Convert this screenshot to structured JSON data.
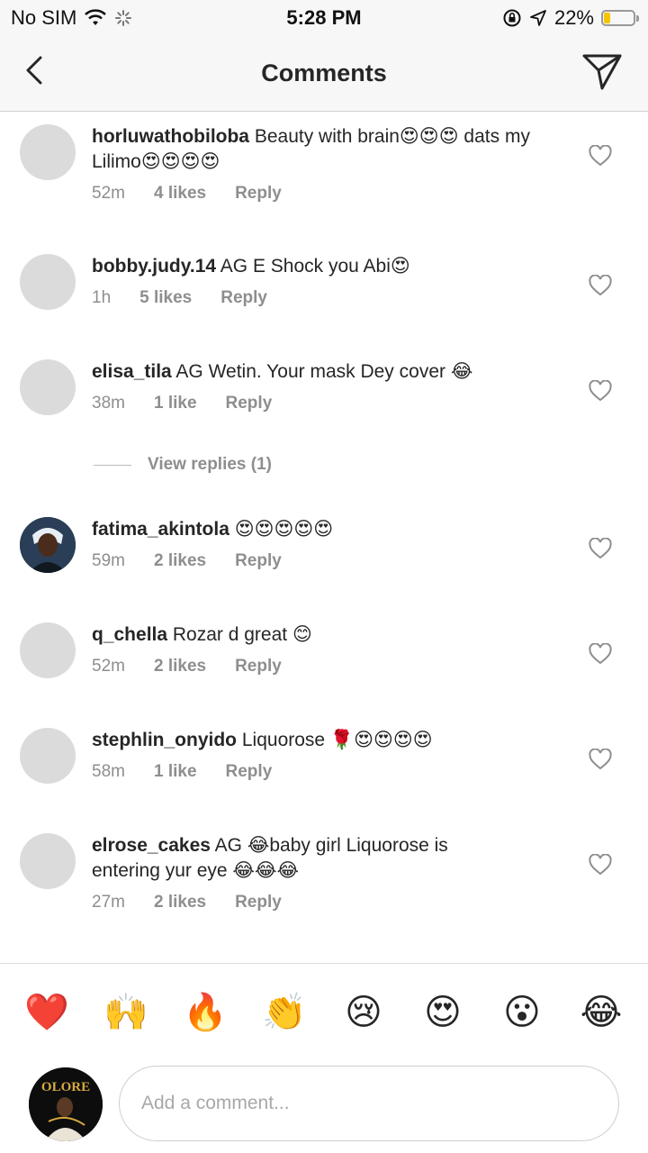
{
  "status": {
    "carrier": "No SIM",
    "time": "5:28 PM",
    "battery_text": "22%",
    "battery_level": 0.22
  },
  "header": {
    "title": "Comments"
  },
  "comments": [
    {
      "username": "horluwathobiloba",
      "text": "Beauty with brain😍😍😍 dats my Lilimo😍😍😍😍",
      "time": "52m",
      "likes": "4 likes",
      "reply": "Reply",
      "avatar": "placeholder"
    },
    {
      "username": "bobby.judy.14",
      "text": "AG E Shock you Abi😍",
      "time": "1h",
      "likes": "5 likes",
      "reply": "Reply",
      "avatar": "placeholder"
    },
    {
      "username": "elisa_tila",
      "text": "AG Wetin. Your mask Dey cover 😂",
      "time": "38m",
      "likes": "1 like",
      "reply": "Reply",
      "avatar": "placeholder"
    },
    {
      "username": "fatima_akintola",
      "text": "😍😍😍😍😍",
      "time": "59m",
      "likes": "2 likes",
      "reply": "Reply",
      "avatar": "photo"
    },
    {
      "username": "q_chella",
      "text": "Rozar d great 😊",
      "time": "52m",
      "likes": "2 likes",
      "reply": "Reply",
      "avatar": "placeholder"
    },
    {
      "username": "stephlin_onyido",
      "text": "Liquorose 🌹😍😍😍😍",
      "time": "58m",
      "likes": "1 like",
      "reply": "Reply",
      "avatar": "placeholder"
    },
    {
      "username": "elrose_cakes",
      "text": "AG 😂baby girl Liquorose is entering yur eye 😂😂😂",
      "time": "27m",
      "likes": "2 likes",
      "reply": "Reply",
      "avatar": "placeholder"
    }
  ],
  "view_replies": "View replies (1)",
  "emoji_bar": [
    "❤️",
    "🙌",
    "🔥",
    "👏",
    "😢",
    "😍",
    "😮",
    "😂"
  ],
  "self_avatar_text": "OLORE",
  "input": {
    "placeholder": "Add a comment..."
  },
  "colors": {
    "secondary_text": "#8e8e8e",
    "placeholder_avatar": "#dbdbdb",
    "battery": "#f5c400"
  },
  "icons": [
    "back-icon",
    "direct-send-icon",
    "heart-outline-icon",
    "wifi-icon",
    "lock-rotation-icon",
    "location-arrow-icon"
  ]
}
